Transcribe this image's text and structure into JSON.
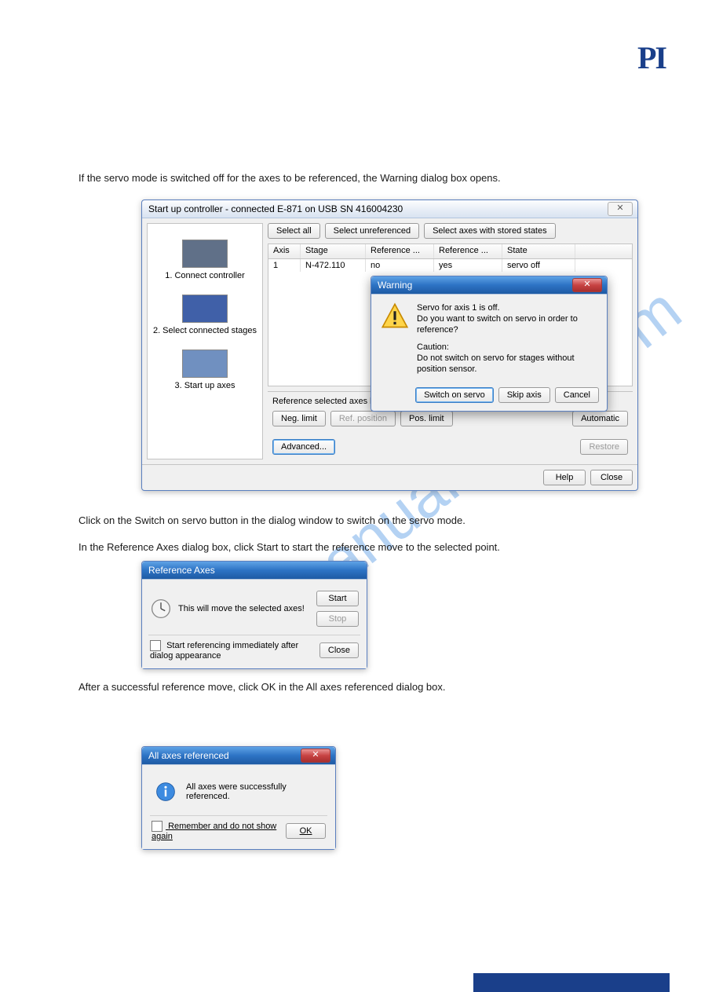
{
  "logo": "PI",
  "watermark": "manualshive.com",
  "page": {
    "number": "",
    "path": ""
  },
  "instructions": {
    "i1": "If the servo mode is switched off for the axes to be referenced, the Warning dialog box opens.",
    "i2": "In the Reference Axes dialog box, click Start to start the reference move to the selected point.",
    "i3": "After a successful reference move, click OK in the All axes referenced dialog box.",
    "i4": "Click on the Switch on servo button in the dialog window to switch on the servo mode."
  },
  "footer": {
    "model": "",
    "doc": ""
  },
  "win1": {
    "title": "Start up controller - connected E-871 on USB SN 416004230",
    "steps": {
      "s1": "1. Connect controller",
      "s2": "2. Select connected stages",
      "s3": "3. Start up axes"
    },
    "toolbar": {
      "selectAll": "Select all",
      "selectUnref": "Select unreferenced",
      "selectStored": "Select axes with stored states"
    },
    "table": {
      "headers": {
        "axis": "Axis",
        "stage": "Stage",
        "ref1": "Reference ...",
        "ref2": "Reference ...",
        "state": "State"
      },
      "row": {
        "axis": "1",
        "stage": "N-472.110",
        "ref1": "no",
        "ref2": "yes",
        "state": "servo off"
      }
    },
    "ref": {
      "label": "Reference selected axes by moving to:",
      "neg": "Neg. limit",
      "pos": "Pos. limit",
      "refpos": "Ref. position",
      "auto": "Automatic"
    },
    "advanced": "Advanced...",
    "restore": "Restore",
    "help": "Help",
    "close": "Close",
    "warn": {
      "title": "Warning",
      "l1": "Servo for axis 1 is off.",
      "l2": "Do you want to switch on servo in order to reference?",
      "l3": "Caution:",
      "l4": "Do not switch on servo for stages without position sensor.",
      "switch": "Switch on servo",
      "skip": "Skip axis",
      "cancel": "Cancel"
    }
  },
  "win2": {
    "title": "Reference Axes",
    "msg": "This will move the selected axes!",
    "start": "Start",
    "stop": "Stop",
    "check": "Start referencing immediately after dialog appearance",
    "close": "Close"
  },
  "win3": {
    "title": "All axes referenced",
    "msg": "All axes were successfully referenced.",
    "check": "Remember and do not show again",
    "ok": "OK"
  }
}
